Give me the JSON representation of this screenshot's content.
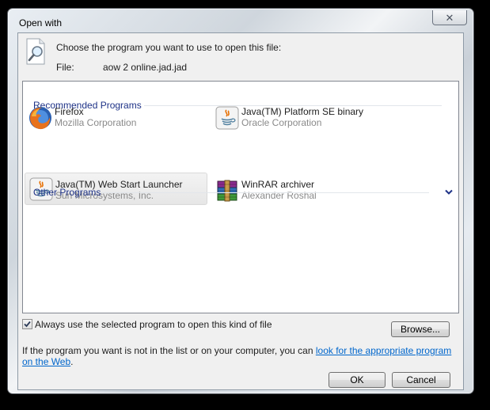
{
  "window": {
    "title": "Open with",
    "close_icon": "close-icon"
  },
  "header": {
    "prompt": "Choose the program you want to use to open this file:",
    "file_label": "File:",
    "file_name": "aow 2 online.jad.jad"
  },
  "recommended": {
    "heading": "Recommended Programs",
    "programs": [
      {
        "name": "Firefox",
        "vendor": "Mozilla Corporation",
        "icon": "firefox-icon"
      },
      {
        "name": "Java(TM) Platform SE binary",
        "vendor": "Oracle Corporation",
        "icon": "java-icon"
      },
      {
        "name": "Java(TM) Web Start Launcher",
        "vendor": "Sun Microsystems, Inc.",
        "icon": "java-icon",
        "selected": true
      },
      {
        "name": "WinRAR archiver",
        "vendor": "Alexander Roshal",
        "icon": "winrar-icon"
      }
    ]
  },
  "other": {
    "heading": "Other Programs",
    "icon": "chevron-down-icon"
  },
  "always_use": {
    "label": "Always use the selected program to open this kind of file",
    "checked": true
  },
  "buttons": {
    "browse": "Browse...",
    "ok": "OK",
    "cancel": "Cancel"
  },
  "info": {
    "text": "If the program you want is not in the list or on your computer, you can ",
    "link": "look for the appropriate program on the Web",
    "suffix": "."
  },
  "colors": {
    "link": "#0066cc",
    "group_heading": "#1e3287"
  }
}
